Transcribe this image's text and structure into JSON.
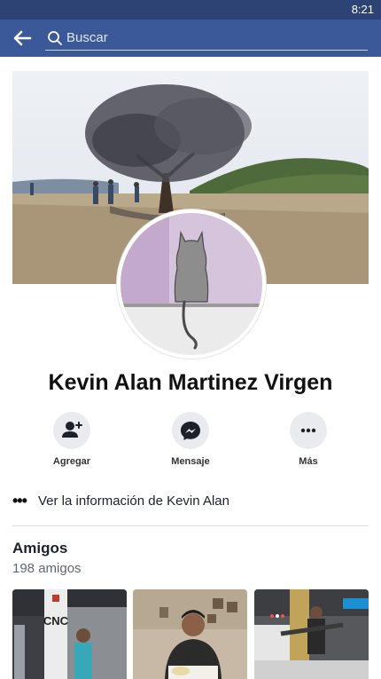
{
  "status_bar": {
    "time": "8:21"
  },
  "app_bar": {
    "search_placeholder": "Buscar"
  },
  "profile": {
    "name": "Kevin Alan Martinez Virgen",
    "actions": [
      {
        "label": "Agregar",
        "icon": "add-friend-icon"
      },
      {
        "label": "Mensaje",
        "icon": "messenger-icon"
      },
      {
        "label": "Más",
        "icon": "more-icon"
      }
    ],
    "info_link": "Ver la información de Kevin Alan"
  },
  "friends": {
    "title": "Amigos",
    "count": "198 amigos",
    "thumbnail_overlay_text": [
      "CNC"
    ]
  },
  "colors": {
    "brand": "#3b5998",
    "status_bar": "#2d4373"
  }
}
